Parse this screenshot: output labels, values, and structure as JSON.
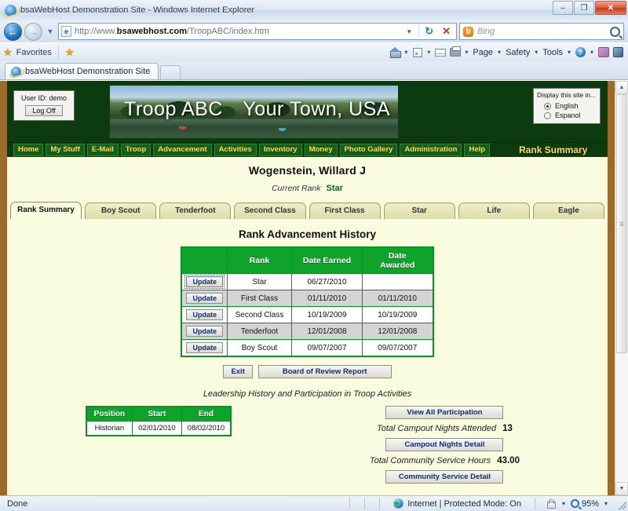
{
  "browser": {
    "title": "bsaWebHost Demonstration Site - Windows Internet Explorer",
    "window_controls": {
      "minimize": "–",
      "maximize": "❐",
      "close": "✕"
    },
    "url_prefix": "http://www.",
    "url_domain": "bsawebhost.com",
    "url_path": "/TroopABC/index.htm",
    "url_dropdown": "▼",
    "refresh": "↻",
    "stop": "✕",
    "search_placeholder": "Bing",
    "search_brand": "b",
    "back_glyph": "←",
    "forward_glyph": "→",
    "history_glyph": "▼",
    "favorites_label": "Favorites",
    "commands": [
      {
        "label": "Page"
      },
      {
        "label": "Safety"
      },
      {
        "label": "Tools"
      }
    ],
    "tab_label": "bsaWebHost Demonstration Site",
    "status": "Done",
    "zone_text": "Internet | Protected Mode: On",
    "zoom_level": "95%"
  },
  "site": {
    "user_id_label": "User ID:  demo",
    "logoff_label": "Log Off",
    "banner_left": "Troop ABC",
    "banner_right": "Your Town, USA",
    "language_label": "Display this site in...",
    "languages": [
      {
        "label": "English",
        "selected": true
      },
      {
        "label": "Espanol",
        "selected": false
      }
    ],
    "nav": [
      "Home",
      "My Stuff",
      "E-Mail",
      "Troop",
      "Advancement",
      "Activities",
      "Inventory",
      "Money",
      "Photo Gallery",
      "Administration",
      "Help"
    ],
    "nav_title": "Rank Summary"
  },
  "page": {
    "person_name": "Wogenstein, Willard J",
    "current_rank_label": "Current Rank",
    "current_rank_value": "Star",
    "tabs": [
      {
        "label": "Rank Summary",
        "active": true
      },
      {
        "label": "Boy Scout",
        "active": false
      },
      {
        "label": "Tenderfoot",
        "active": false
      },
      {
        "label": "Second Class",
        "active": false
      },
      {
        "label": "First Class",
        "active": false
      },
      {
        "label": "Star",
        "active": false
      },
      {
        "label": "Life",
        "active": false
      },
      {
        "label": "Eagle",
        "active": false
      }
    ],
    "section_title": "Rank Advancement History",
    "rank_table": {
      "headers": [
        "",
        "Rank",
        "Date Earned",
        "Date Awarded"
      ],
      "update_label": "Update",
      "rows": [
        {
          "rank": "Star",
          "date_earned": "06/27/2010",
          "date_awarded": ""
        },
        {
          "rank": "First Class",
          "date_earned": "01/11/2010",
          "date_awarded": "01/11/2010"
        },
        {
          "rank": "Second Class",
          "date_earned": "10/19/2009",
          "date_awarded": "10/19/2009"
        },
        {
          "rank": "Tenderfoot",
          "date_earned": "12/01/2008",
          "date_awarded": "12/01/2008"
        },
        {
          "rank": "Boy Scout",
          "date_earned": "09/07/2007",
          "date_awarded": "09/07/2007"
        }
      ]
    },
    "actions": {
      "exit_label": "Exit",
      "board_of_review_label": "Board of Review Report"
    },
    "leadership_title": "Leadership History and Participation in Troop Activities",
    "position_table": {
      "headers": [
        "Position",
        "Start",
        "End"
      ],
      "rows": [
        {
          "position": "Historian",
          "start": "02/01/2010",
          "end": "08/02/2010"
        }
      ]
    },
    "participation": {
      "view_all_label": "View All Participation",
      "campout_label": "Total Campout Nights Attended",
      "campout_value": "13",
      "campout_detail_label": "Campout Nights Detail",
      "service_label": "Total Community Service Hours",
      "service_value": "43.00",
      "service_detail_label": "Community Service Detail"
    }
  },
  "colors": {
    "site_dark_green": "#0c3b10",
    "nav_yellow": "#ffe14d",
    "table_green": "#10a32c",
    "page_cream": "#fafce0",
    "frame_brown": "#9c6a2a"
  }
}
